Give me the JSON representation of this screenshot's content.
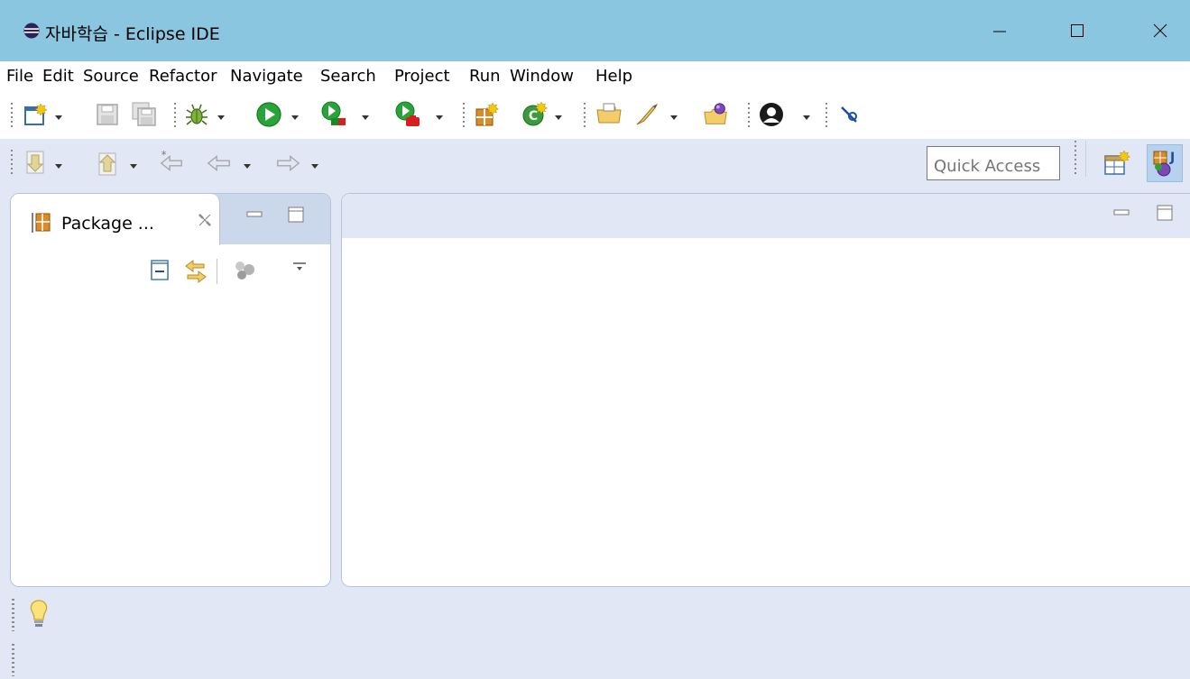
{
  "window": {
    "title": "자바학습 - Eclipse IDE",
    "app_icon": "eclipse-icon",
    "controls": [
      "minimize-icon",
      "maximize-icon",
      "close-icon"
    ]
  },
  "menubar": {
    "items": [
      "File",
      "Edit",
      "Source",
      "Refactor",
      "Navigate",
      "Search",
      "Project",
      "Run",
      "Window",
      "Help"
    ]
  },
  "toolbar": {
    "row1_icons": [
      "new-wizard-icon",
      "save-icon",
      "save-all-icon",
      "debug-icon",
      "run-icon",
      "coverage-icon",
      "run-last-tool-icon",
      "new-java-package-icon",
      "new-java-class-icon",
      "open-type-icon",
      "open-task-icon",
      "search-icon",
      "user-icon",
      "toggle-breakpoints-icon"
    ],
    "row2_icons": [
      "next-annotation-icon",
      "previous-annotation-icon",
      "last-edit-location-icon",
      "back-icon",
      "forward-icon"
    ]
  },
  "quick_access": {
    "placeholder": "Quick Access"
  },
  "perspectives": [
    "open-perspective-icon",
    "java-perspective-icon"
  ],
  "package_explorer": {
    "tab_label": "Package ...",
    "actions": [
      "collapse-all-icon",
      "link-with-editor-icon",
      "focus-on-active-task-icon",
      "view-menu-icon"
    ]
  },
  "editor_area": {
    "controls": [
      "minimize-icon",
      "maximize-icon"
    ]
  },
  "colors": {
    "titlebar": "#8ac6e0",
    "workbench_bg": "#e2e7f5",
    "panel_bg": "#ffffff",
    "tab_header": "#cbd8ec",
    "active_perspective": "#b7d2ee"
  }
}
